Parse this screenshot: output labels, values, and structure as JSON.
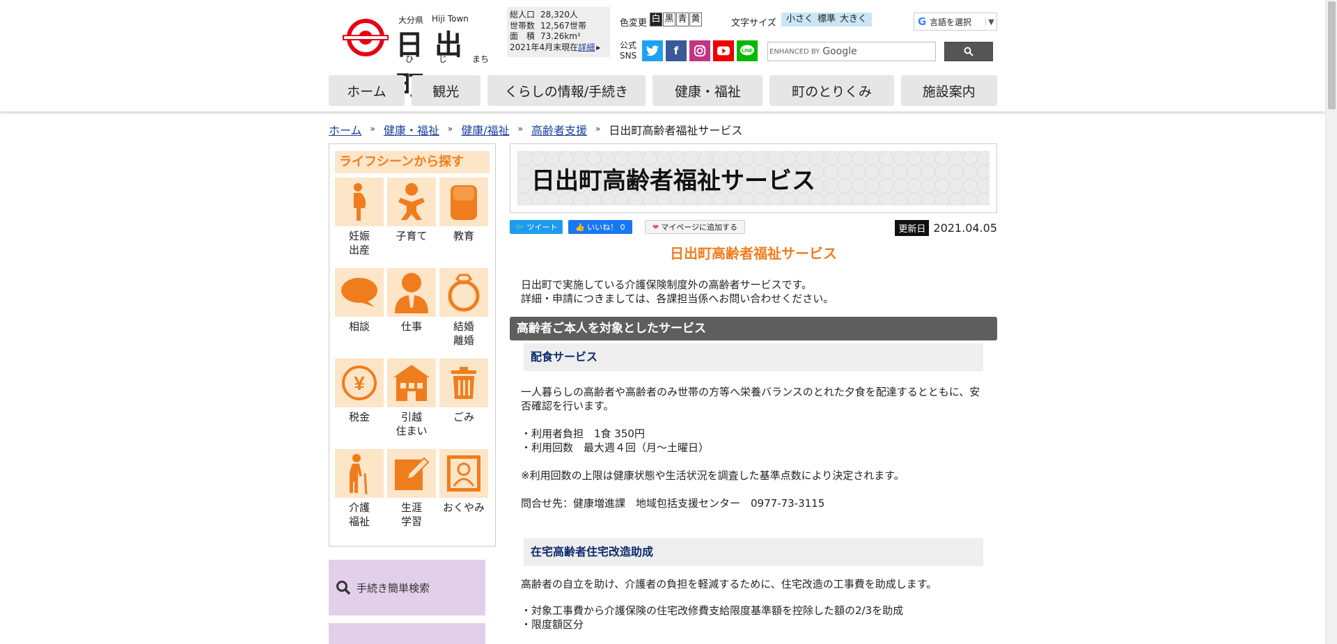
{
  "header": {
    "logo": {
      "pref": "大分県",
      "town_en": "Hiji Town",
      "name": "日出町",
      "kana": [
        "ひ",
        "じ",
        "まち"
      ]
    },
    "stats": {
      "rows": [
        {
          "k": "総人口",
          "v": "28,320人"
        },
        {
          "k": "世帯数",
          "v": "12,567世帯"
        },
        {
          "k": "面　積",
          "v": "73.26km²"
        }
      ],
      "asof": "2021年4月末現在",
      "more": "詳細"
    },
    "color": {
      "label": "色変更",
      "options": [
        "白",
        "黒",
        "青",
        "黄"
      ]
    },
    "fontsize": {
      "label": "文字サイズ",
      "options": [
        "小さく",
        "標準",
        "大きく"
      ]
    },
    "translate": "言語を選択",
    "sns_label": "公式\nSNS",
    "search": {
      "enhanced": "ENHANCED BY",
      "google": "Google"
    },
    "nav": [
      "ホーム",
      "観光",
      "くらしの情報/手続き",
      "健康・福祉",
      "町のとりくみ",
      "施設案内"
    ]
  },
  "breadcrumb": [
    "ホーム",
    "健康・福祉",
    "健康/福祉",
    "高齢者支援",
    "日出町高齢者福祉サービス"
  ],
  "sidebar": {
    "title": "ライフシーンから探す",
    "scenes": [
      {
        "label": "妊娠\n出産",
        "icon": "pregnancy-icon"
      },
      {
        "label": "子育て",
        "icon": "baby-icon"
      },
      {
        "label": "教育",
        "icon": "school-bag-icon"
      },
      {
        "label": "相談",
        "icon": "speech-bubble-icon"
      },
      {
        "label": "仕事",
        "icon": "businessman-icon"
      },
      {
        "label": "結婚\n離婚",
        "icon": "ring-icon"
      },
      {
        "label": "税金",
        "icon": "yen-icon"
      },
      {
        "label": "引越\n住まい",
        "icon": "house-icon"
      },
      {
        "label": "ごみ",
        "icon": "trash-icon"
      },
      {
        "label": "介護\n福祉",
        "icon": "elderly-icon"
      },
      {
        "label": "生涯\n学習",
        "icon": "pencil-icon"
      },
      {
        "label": "おくやみ",
        "icon": "portrait-icon"
      }
    ],
    "procedure_search": "手続き簡単検索"
  },
  "main": {
    "page_title": "日出町高齢者福祉サービス",
    "share": {
      "tweet": "ツイート",
      "like": "いいね！ 0",
      "mypage": "マイページに追加する"
    },
    "updated": {
      "label": "更新日",
      "date": "2021.04.05"
    },
    "heading": "日出町高齢者福祉サービス",
    "intro": [
      "日出町で実施している介護保険制度外の高齢者サービスです。",
      "詳細・申請につきましては、各課担当係へお問い合わせください。"
    ],
    "section1": "高齢者ご本人を対象としたサービス",
    "service1": {
      "title": "配食サービス",
      "desc": "一人暮らしの高齢者や高齢者のみ世帯の方等へ栄養バランスのとれた夕食を配達するとともに、安否確認を行います。",
      "items": [
        "・利用者負担　1食 350円",
        "・利用回数　最大週４回（月～土曜日）"
      ],
      "note": "※利用回数の上限は健康状態や生活状況を調査した基準点数により決定されます。",
      "contact": "問合せ先：健康増進課　地域包括支援センター　0977-73-3115"
    },
    "service2": {
      "title": "在宅高齢者住宅改造助成",
      "desc": "高齢者の自立を助け、介護者の負担を軽減するために、住宅改造の工事費を助成します。",
      "items": [
        "・対象工事費から介護保険の住宅改修費支給限度基準額を控除した額の2/3を助成",
        "・限度額区分"
      ]
    }
  },
  "colors": {
    "accent": "#f07d1d",
    "accent_light": "#fde5c8",
    "link": "#1a3f9c",
    "section": "#5e5e5e",
    "purple": "#e2cfe9"
  }
}
